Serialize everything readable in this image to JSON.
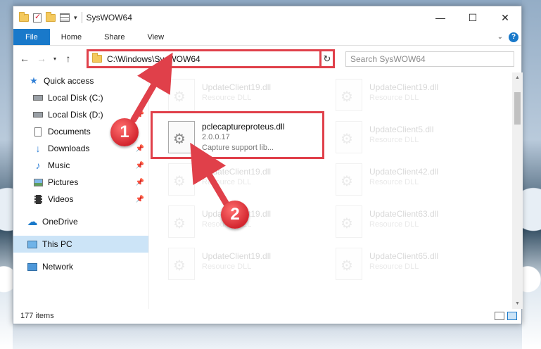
{
  "window": {
    "title": "SysWOW64",
    "controls": {
      "minimize": "—",
      "maximize": "☐",
      "close": "✕"
    }
  },
  "ribbon": {
    "tabs": [
      "File",
      "Home",
      "Share",
      "View"
    ],
    "help": "?"
  },
  "address": {
    "path": "C:\\Windows\\SysWOW64",
    "search_placeholder": "Search SysWOW64"
  },
  "nav_pane": {
    "items": [
      {
        "label": "Quick access",
        "icon": "star-icon"
      },
      {
        "label": "Local Disk (C:)",
        "icon": "disk-icon"
      },
      {
        "label": "Local Disk (D:)",
        "icon": "disk-icon"
      },
      {
        "label": "Documents",
        "icon": "documents-icon"
      },
      {
        "label": "Downloads",
        "icon": "downloads-icon"
      },
      {
        "label": "Music",
        "icon": "music-icon"
      },
      {
        "label": "Pictures",
        "icon": "pictures-icon"
      },
      {
        "label": "Videos",
        "icon": "videos-icon"
      },
      {
        "label": "OneDrive",
        "icon": "onedrive-icon"
      },
      {
        "label": "This PC",
        "icon": "this-pc-icon"
      },
      {
        "label": "Network",
        "icon": "network-icon"
      }
    ]
  },
  "files": {
    "highlighted": {
      "name": "pclecaptureproteus.dll",
      "version": "2.0.0.17",
      "description": "Capture support lib..."
    },
    "ghost": [
      {
        "name": "UpdateClient19.dll",
        "type": "Resource DLL"
      },
      {
        "name": "UpdateClient19.dll",
        "type": "Resource DLL"
      },
      {
        "name": "UpdateClient5.dll",
        "type": "Resource DLL"
      },
      {
        "name": "UpdateClient19.dll",
        "type": "Resource DLL"
      },
      {
        "name": "UpdateClient42.dll",
        "type": "Resource DLL"
      },
      {
        "name": "UpdateClient19.dll",
        "type": "Resource DLL"
      },
      {
        "name": "UpdateClient63.dll",
        "type": "Resource DLL"
      },
      {
        "name": "UpdateClient19.dll",
        "type": "Resource DLL"
      },
      {
        "name": "UpdateClient65.dll",
        "type": "Resource DLL"
      }
    ]
  },
  "status": {
    "count": "177 items"
  },
  "annotations": {
    "step1": "1",
    "step2": "2",
    "color": "#e0404a"
  }
}
